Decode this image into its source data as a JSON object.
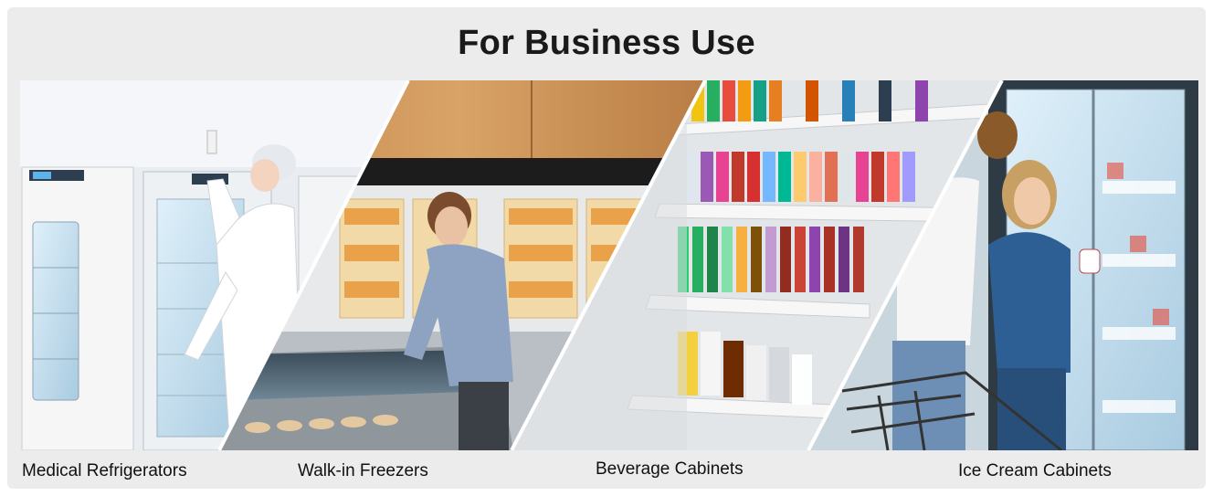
{
  "header": {
    "title": "For Business Use"
  },
  "categories": [
    {
      "label": "Medical Refrigerators"
    },
    {
      "label": "Walk-in Freezers"
    },
    {
      "label": "Beverage Cabinets"
    },
    {
      "label": "Ice Cream Cabinets"
    }
  ]
}
